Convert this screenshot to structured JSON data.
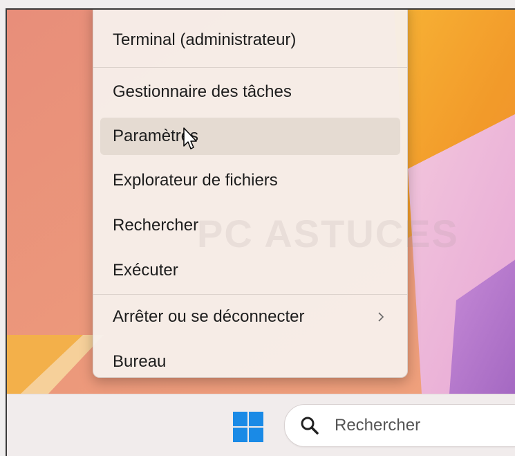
{
  "context_menu": {
    "items": [
      {
        "label": "Terminal (administrateur)"
      },
      {
        "label": "Gestionnaire des tâches"
      },
      {
        "label": "Paramètres"
      },
      {
        "label": "Explorateur de fichiers"
      },
      {
        "label": "Rechercher"
      },
      {
        "label": "Exécuter"
      },
      {
        "label": "Arrêter ou se déconnecter",
        "has_submenu": true
      },
      {
        "label": "Bureau"
      }
    ],
    "hovered_item": "Paramètres"
  },
  "watermark": {
    "text": "PC ASTUCES"
  },
  "taskbar": {
    "start_icon": "windows-logo-icon",
    "search": {
      "icon": "search-icon",
      "placeholder": "Rechercher"
    }
  },
  "colors": {
    "start_blue": "#1a8ae6",
    "menu_bg": "#f7f0ec"
  }
}
